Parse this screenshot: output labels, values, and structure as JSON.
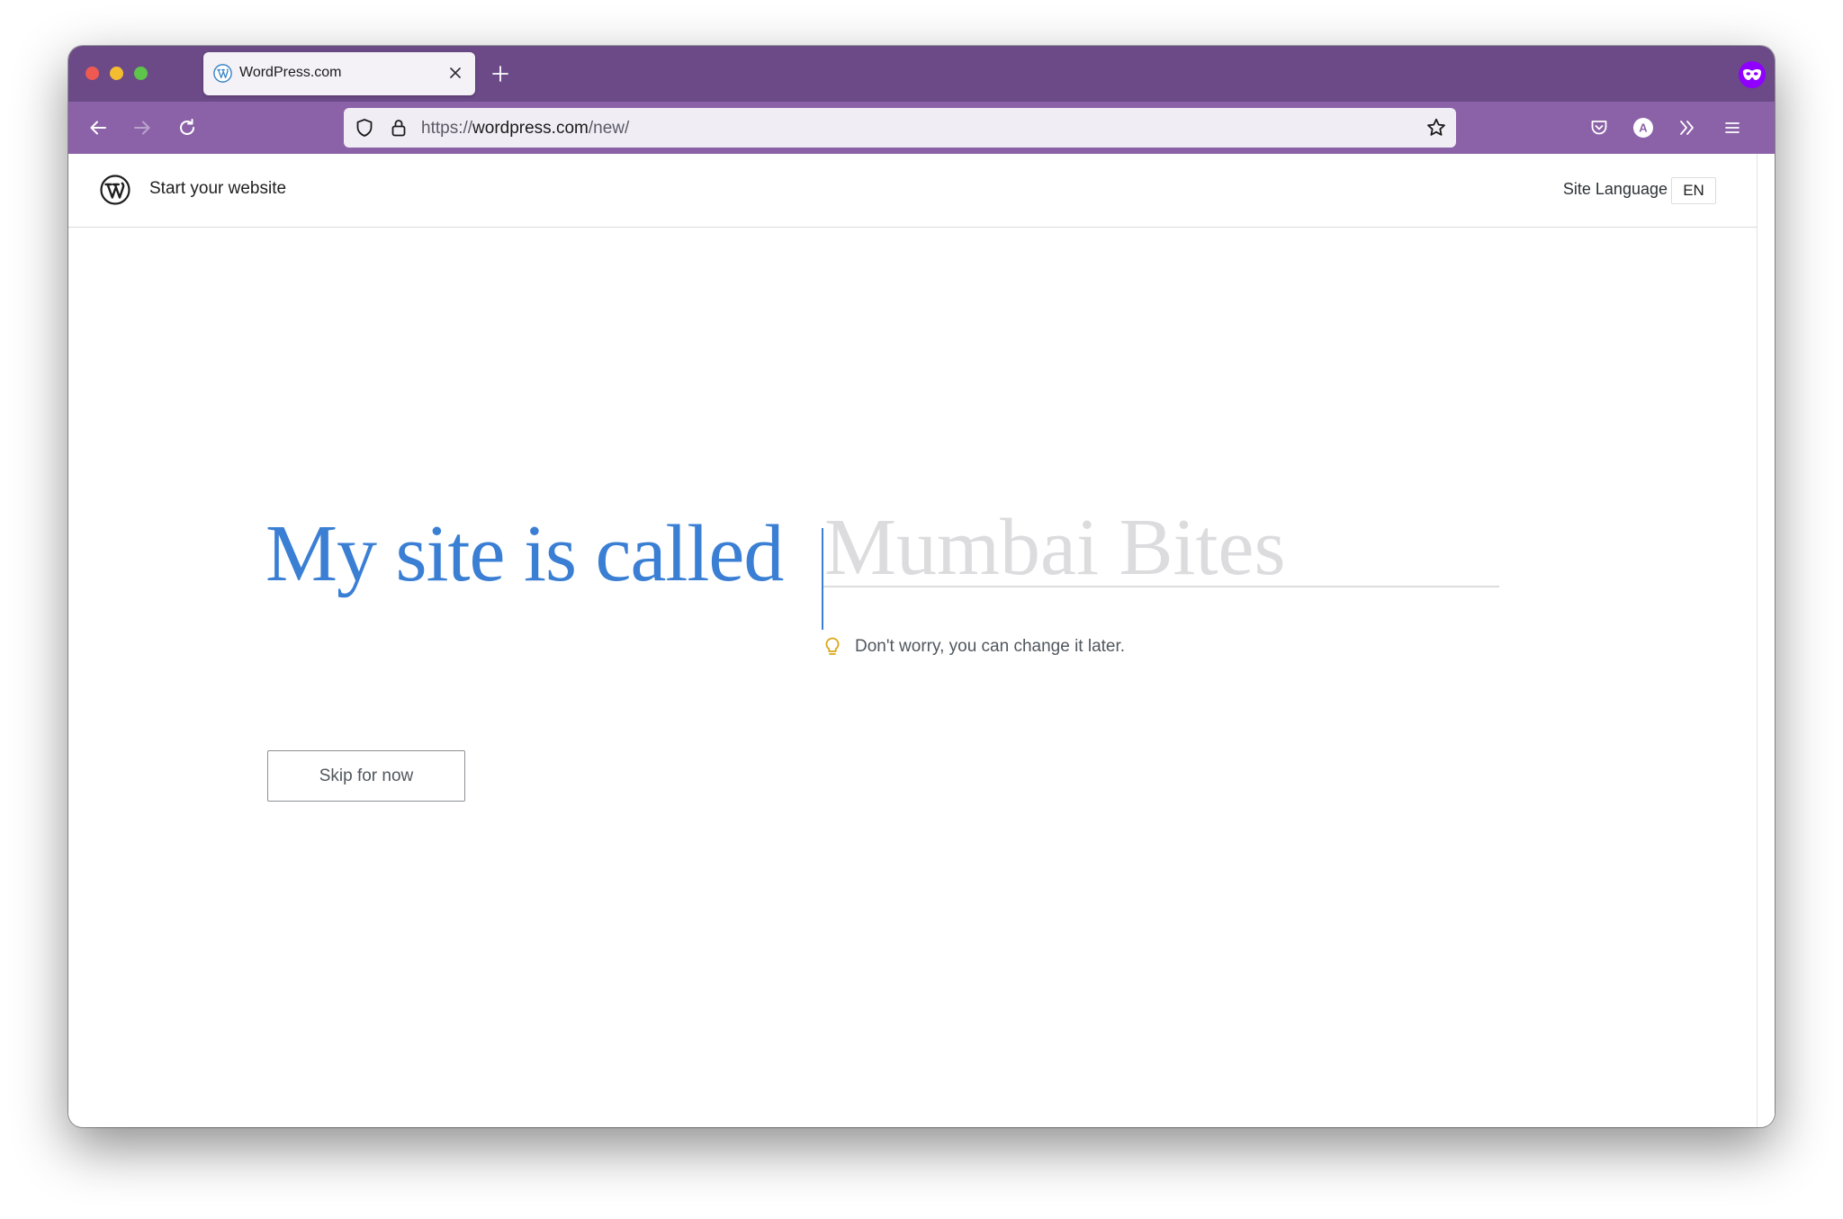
{
  "browser": {
    "tab": {
      "title": "WordPress.com"
    },
    "url": {
      "scheme": "https://",
      "host": "wordpress.com",
      "path": "/new/"
    },
    "profile_initial": "A",
    "colors": {
      "tabstrip": "#6b4a87",
      "navbar": "#8b62a8",
      "private_badge": "#8f00ff"
    }
  },
  "header": {
    "title": "Start your website",
    "site_language_label": "Site Language",
    "site_language_value": "EN"
  },
  "main": {
    "headline": "My site is called",
    "site_name_placeholder": "Mumbai Bites",
    "site_name_value": "",
    "hint": "Don't worry, you can change it later.",
    "skip_label": "Skip for now"
  },
  "colors": {
    "accent": "#3a7fd4",
    "hint_icon": "#dba617"
  }
}
